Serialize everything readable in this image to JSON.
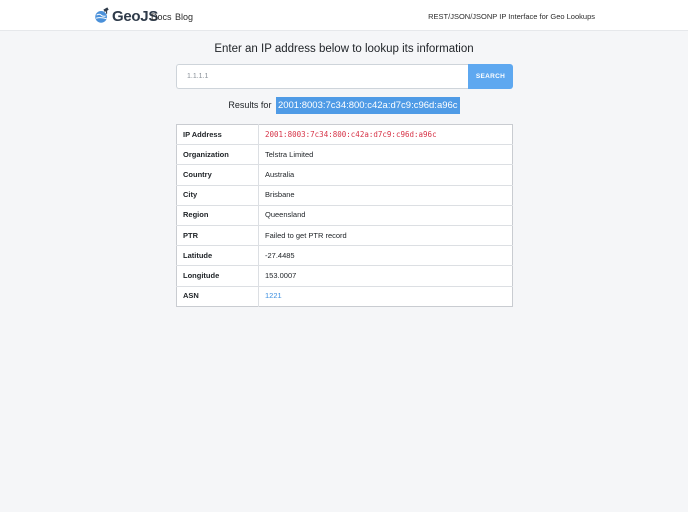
{
  "header": {
    "brand": "GeoJS",
    "brand_logo_icon": "globe-satellite-icon",
    "links": [
      {
        "label": "Docs"
      },
      {
        "label": "Blog"
      }
    ],
    "tagline": "REST/JSON/JSONP IP Interface for Geo Lookups"
  },
  "main": {
    "heading": "Enter an IP address below to lookup its information",
    "search": {
      "placeholder": "1.1.1.1",
      "value": "",
      "button_label": "SEARCH"
    },
    "results_prefix": "Results for",
    "results_ip": "2001:8003:7c34:800:c42a:d7c9:c96d:a96c",
    "table": {
      "rows": [
        {
          "key": "IP Address",
          "value": "2001:8003:7c34:800:c42a:d7c9:c96d:a96c"
        },
        {
          "key": "Organization",
          "value": "Telstra Limited"
        },
        {
          "key": "Country",
          "value": "Australia"
        },
        {
          "key": "City",
          "value": "Brisbane"
        },
        {
          "key": "Region",
          "value": "Queensland"
        },
        {
          "key": "PTR",
          "value": "Failed to get PTR record"
        },
        {
          "key": "Latitude",
          "value": "-27.4485"
        },
        {
          "key": "Longitude",
          "value": "153.0007"
        },
        {
          "key": "ASN",
          "value": "1221"
        }
      ]
    }
  },
  "colors": {
    "accent": "#5ea8f0",
    "highlight": "#4f9be6",
    "ip_code": "#d63347",
    "link": "#3c8fe0",
    "page_bg": "#f5f6f8"
  }
}
